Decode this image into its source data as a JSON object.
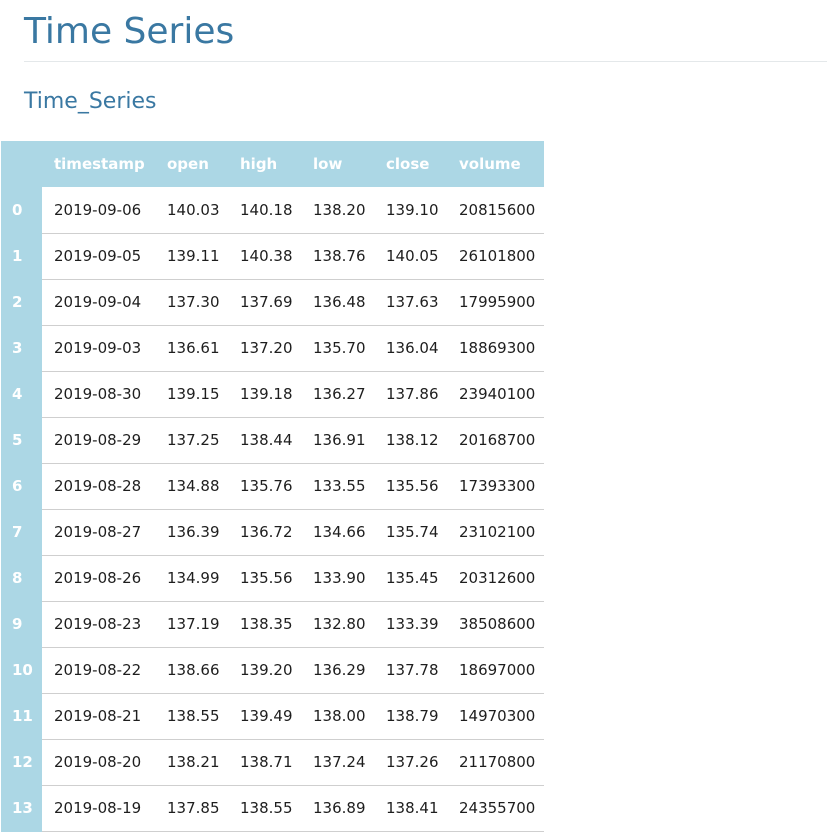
{
  "title": "Time Series",
  "subtitle": "Time_Series",
  "columns": [
    "timestamp",
    "open",
    "high",
    "low",
    "close",
    "volume"
  ],
  "rows": [
    {
      "index": "0",
      "timestamp": "2019-09-06",
      "open": "140.03",
      "high": "140.18",
      "low": "138.20",
      "close": "139.10",
      "volume": "20815600"
    },
    {
      "index": "1",
      "timestamp": "2019-09-05",
      "open": "139.11",
      "high": "140.38",
      "low": "138.76",
      "close": "140.05",
      "volume": "26101800"
    },
    {
      "index": "2",
      "timestamp": "2019-09-04",
      "open": "137.30",
      "high": "137.69",
      "low": "136.48",
      "close": "137.63",
      "volume": "17995900"
    },
    {
      "index": "3",
      "timestamp": "2019-09-03",
      "open": "136.61",
      "high": "137.20",
      "low": "135.70",
      "close": "136.04",
      "volume": "18869300"
    },
    {
      "index": "4",
      "timestamp": "2019-08-30",
      "open": "139.15",
      "high": "139.18",
      "low": "136.27",
      "close": "137.86",
      "volume": "23940100"
    },
    {
      "index": "5",
      "timestamp": "2019-08-29",
      "open": "137.25",
      "high": "138.44",
      "low": "136.91",
      "close": "138.12",
      "volume": "20168700"
    },
    {
      "index": "6",
      "timestamp": "2019-08-28",
      "open": "134.88",
      "high": "135.76",
      "low": "133.55",
      "close": "135.56",
      "volume": "17393300"
    },
    {
      "index": "7",
      "timestamp": "2019-08-27",
      "open": "136.39",
      "high": "136.72",
      "low": "134.66",
      "close": "135.74",
      "volume": "23102100"
    },
    {
      "index": "8",
      "timestamp": "2019-08-26",
      "open": "134.99",
      "high": "135.56",
      "low": "133.90",
      "close": "135.45",
      "volume": "20312600"
    },
    {
      "index": "9",
      "timestamp": "2019-08-23",
      "open": "137.19",
      "high": "138.35",
      "low": "132.80",
      "close": "133.39",
      "volume": "38508600"
    },
    {
      "index": "10",
      "timestamp": "2019-08-22",
      "open": "138.66",
      "high": "139.20",
      "low": "136.29",
      "close": "137.78",
      "volume": "18697000"
    },
    {
      "index": "11",
      "timestamp": "2019-08-21",
      "open": "138.55",
      "high": "139.49",
      "low": "138.00",
      "close": "138.79",
      "volume": "14970300"
    },
    {
      "index": "12",
      "timestamp": "2019-08-20",
      "open": "138.21",
      "high": "138.71",
      "low": "137.24",
      "close": "137.26",
      "volume": "21170800"
    },
    {
      "index": "13",
      "timestamp": "2019-08-19",
      "open": "137.85",
      "high": "138.55",
      "low": "136.89",
      "close": "138.41",
      "volume": "24355700"
    }
  ],
  "colors": {
    "heading": "#3a78a2",
    "table_header_bg": "#acd7e5",
    "table_header_text": "#ffffff",
    "row_border": "#cfcfcf",
    "cell_text": "#1e1e1e"
  }
}
